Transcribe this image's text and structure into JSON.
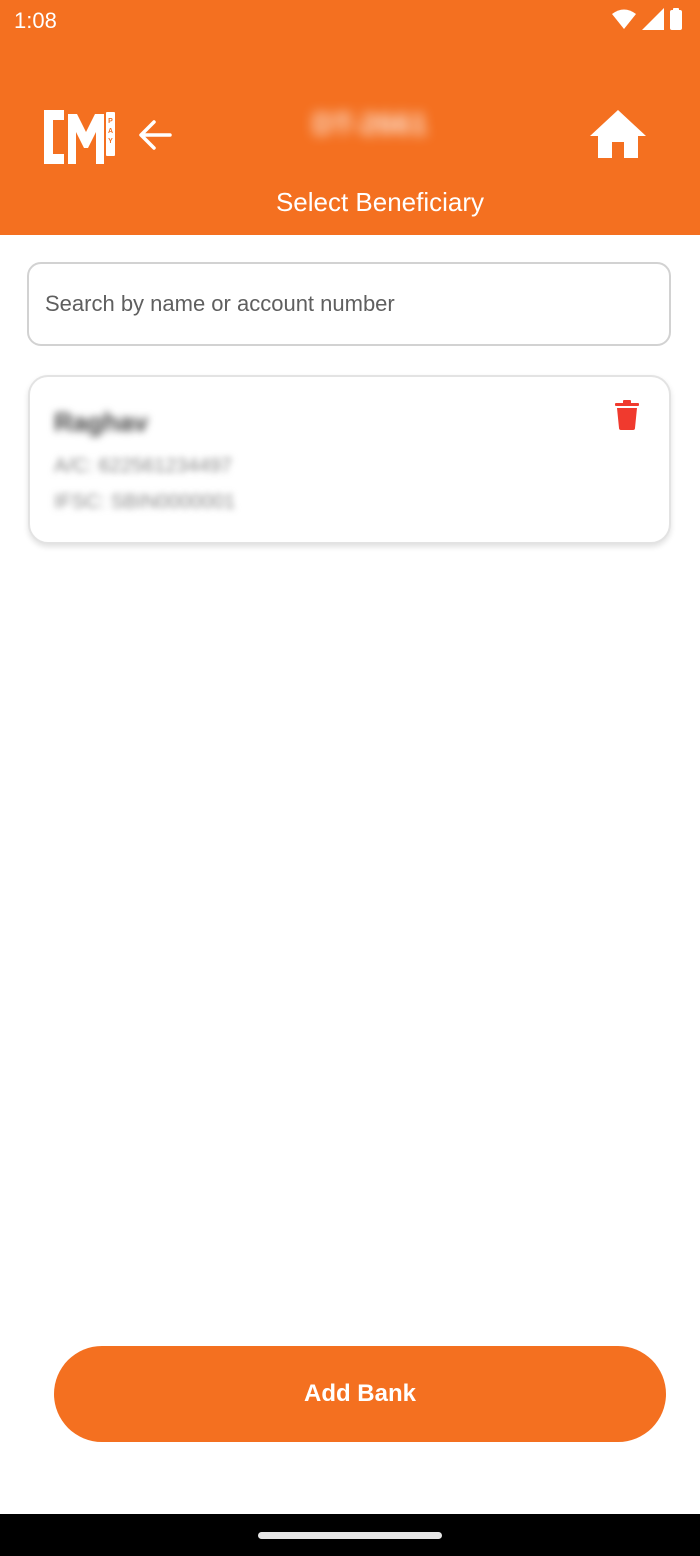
{
  "status_bar": {
    "time": "1:08",
    "icons": [
      "wifi-icon",
      "signal-icon",
      "battery-icon"
    ]
  },
  "header": {
    "logo_text": "CM PAY",
    "merchant_id": "DT-2661",
    "title": "Select Beneficiary",
    "background_color": "#f47020"
  },
  "search": {
    "placeholder": "Search by name or account number",
    "value": ""
  },
  "beneficiaries": [
    {
      "name": "Raghav",
      "account": "A/C: 622561234497",
      "ifsc": "IFSC: SBIN0000001"
    }
  ],
  "actions": {
    "add_bank_label": "Add Bank"
  },
  "colors": {
    "accent": "#f47020",
    "delete": "#f03a2e"
  }
}
